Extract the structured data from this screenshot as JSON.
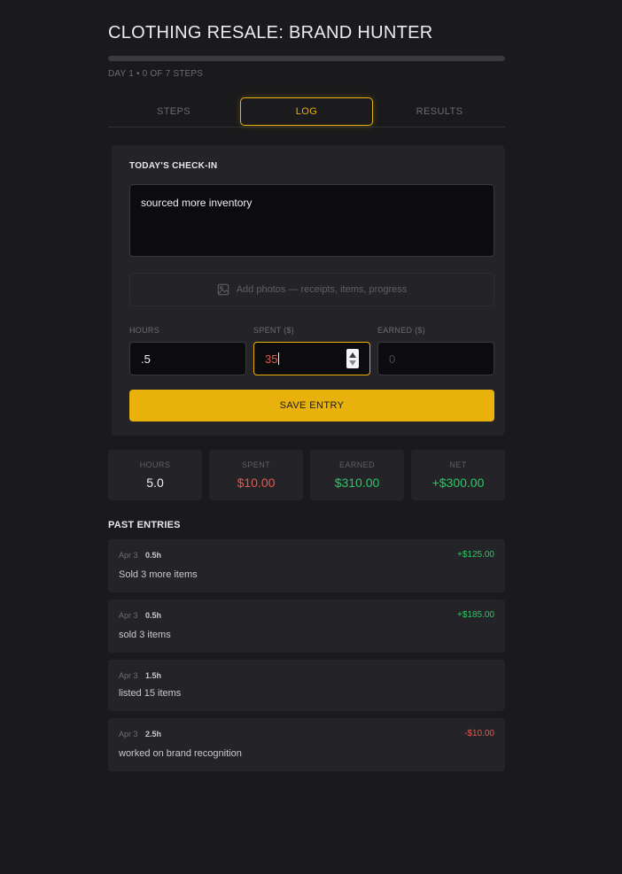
{
  "header": {
    "title": "CLOTHING RESALE: BRAND HUNTER",
    "meta": "DAY 1 • 0 OF 7 STEPS",
    "progress_fraction": 0
  },
  "tabs": [
    {
      "label": "STEPS",
      "active": false
    },
    {
      "label": "LOG",
      "active": true
    },
    {
      "label": "RESULTS",
      "active": false
    }
  ],
  "checkin": {
    "label": "TODAY'S CHECK-IN",
    "note_value": "sourced more inventory",
    "photos_label": "Add photos — receipts, items, progress",
    "fields": {
      "hours": {
        "label": "HOURS",
        "value": ".5"
      },
      "spent": {
        "label": "SPENT ($)",
        "value": "35"
      },
      "earned": {
        "label": "EARNED ($)",
        "placeholder": "0"
      }
    },
    "save_label": "SAVE ENTRY"
  },
  "stats": [
    {
      "label": "HOURS",
      "value": "5.0",
      "tone": "neutral"
    },
    {
      "label": "SPENT",
      "value": "$10.00",
      "tone": "red"
    },
    {
      "label": "EARNED",
      "value": "$310.00",
      "tone": "green"
    },
    {
      "label": "NET",
      "value": "+$300.00",
      "tone": "green"
    }
  ],
  "past": {
    "title": "PAST ENTRIES",
    "entries": [
      {
        "date": "Apr 3",
        "hours": "0.5h",
        "amount": "+$125.00",
        "tone": "green",
        "desc": "Sold 3 more items"
      },
      {
        "date": "Apr 3",
        "hours": "0.5h",
        "amount": "+$185.00",
        "tone": "green",
        "desc": "sold 3 items"
      },
      {
        "date": "Apr 3",
        "hours": "1.5h",
        "amount": "",
        "tone": "neutral",
        "desc": "listed 15 items"
      },
      {
        "date": "Apr 3",
        "hours": "2.5h",
        "amount": "-$10.00",
        "tone": "red",
        "desc": "worked on brand recognition"
      }
    ]
  },
  "colors": {
    "accent": "#e8b10c",
    "negative": "#e05a4e",
    "positive": "#2fc466",
    "background": "#1a1a1c",
    "card": "#242428"
  }
}
